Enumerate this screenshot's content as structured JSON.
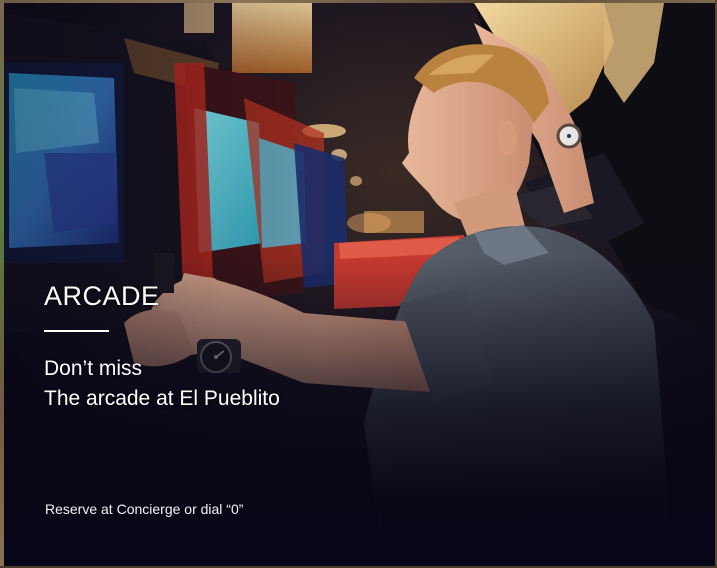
{
  "card": {
    "heading": "ARCADE",
    "subtitle_line1": "Don’t miss",
    "subtitle_line2": "The arcade at El Pueblito",
    "reserve_note": "Reserve at Concierge or dial “0”"
  },
  "photo": {
    "subject": "arcade-photo"
  },
  "colors": {
    "overlay_dark": "#07061a",
    "text": "#ffffff"
  }
}
